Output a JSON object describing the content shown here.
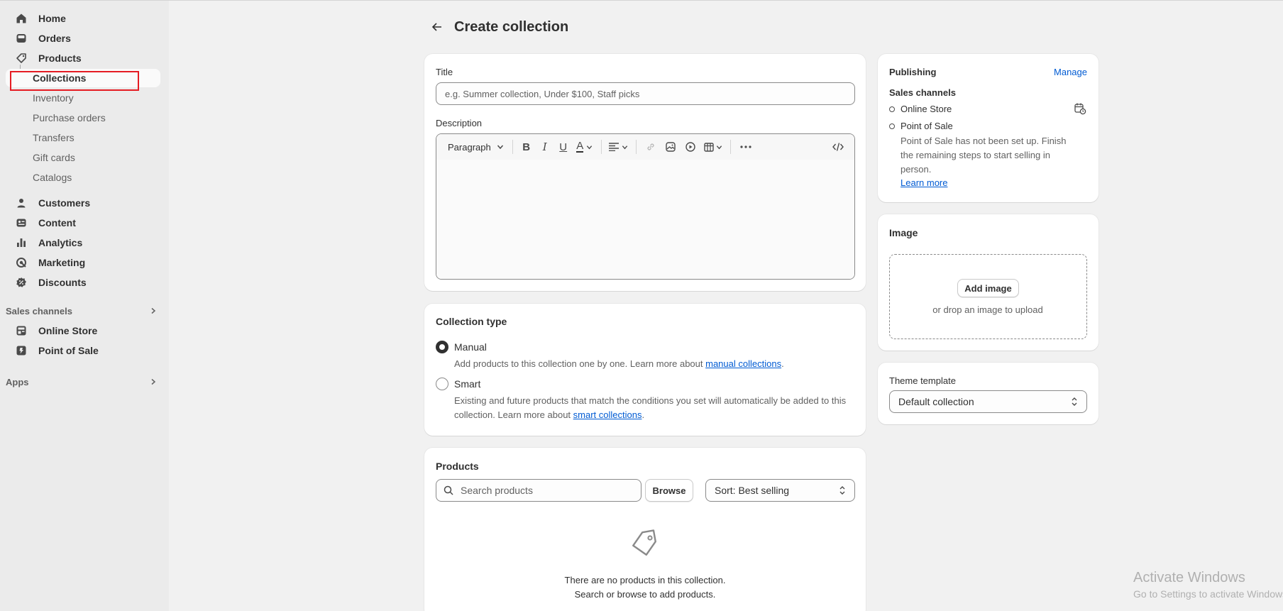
{
  "sidebar": {
    "items": [
      {
        "label": "Home",
        "icon": "home-icon"
      },
      {
        "label": "Orders",
        "icon": "inbox-icon"
      },
      {
        "label": "Products",
        "icon": "tag-icon"
      }
    ],
    "product_sub_items": [
      {
        "label": "Collections",
        "active": true
      },
      {
        "label": "Inventory"
      },
      {
        "label": "Purchase orders"
      },
      {
        "label": "Transfers"
      },
      {
        "label": "Gift cards"
      },
      {
        "label": "Catalogs"
      }
    ],
    "items2": [
      {
        "label": "Customers",
        "icon": "person-icon"
      },
      {
        "label": "Content",
        "icon": "content-icon"
      },
      {
        "label": "Analytics",
        "icon": "chart-icon"
      },
      {
        "label": "Marketing",
        "icon": "target-icon"
      },
      {
        "label": "Discounts",
        "icon": "discount-icon"
      }
    ],
    "sales_channels_label": "Sales channels",
    "channels": [
      {
        "label": "Online Store",
        "icon": "store-icon"
      },
      {
        "label": "Point of Sale",
        "icon": "pos-icon"
      }
    ],
    "apps_label": "Apps"
  },
  "page": {
    "title": "Create collection"
  },
  "details": {
    "title_label": "Title",
    "title_placeholder": "e.g. Summer collection, Under $100, Staff picks",
    "description_label": "Description",
    "format_select": "Paragraph"
  },
  "collection_type": {
    "heading": "Collection type",
    "manual_label": "Manual",
    "manual_help": "Add products to this collection one by one. Learn more about ",
    "manual_link": "manual collections",
    "smart_label": "Smart",
    "smart_help_1": "Existing and future products that match the conditions you set will automatically be added to this",
    "smart_help_2": "collection. Learn more about ",
    "smart_link": "smart collections",
    "selected": "Manual"
  },
  "products": {
    "heading": "Products",
    "search_placeholder": "Search products",
    "browse_label": "Browse",
    "sort_label": "Sort: Best selling",
    "empty_line1": "There are no products in this collection.",
    "empty_line2": "Search or browse to add products."
  },
  "publishing": {
    "heading": "Publishing",
    "manage_label": "Manage",
    "sales_channels_label": "Sales channels",
    "channel1": "Online Store",
    "channel2": "Point of Sale",
    "pos_note_1": "Point of Sale has not been set up. Finish",
    "pos_note_2": "the remaining steps to start selling in",
    "pos_note_3": "person.",
    "learn_more": "Learn more"
  },
  "image": {
    "heading": "Image",
    "add_label": "Add image",
    "drop_text": "or drop an image to upload"
  },
  "theme": {
    "label": "Theme template",
    "value": "Default collection"
  },
  "watermark": {
    "line1": "Activate Windows",
    "line2": "Go to Settings to activate Windows."
  },
  "colors": {
    "accent_link": "#005bd3",
    "highlight_box": "#e51c23"
  }
}
